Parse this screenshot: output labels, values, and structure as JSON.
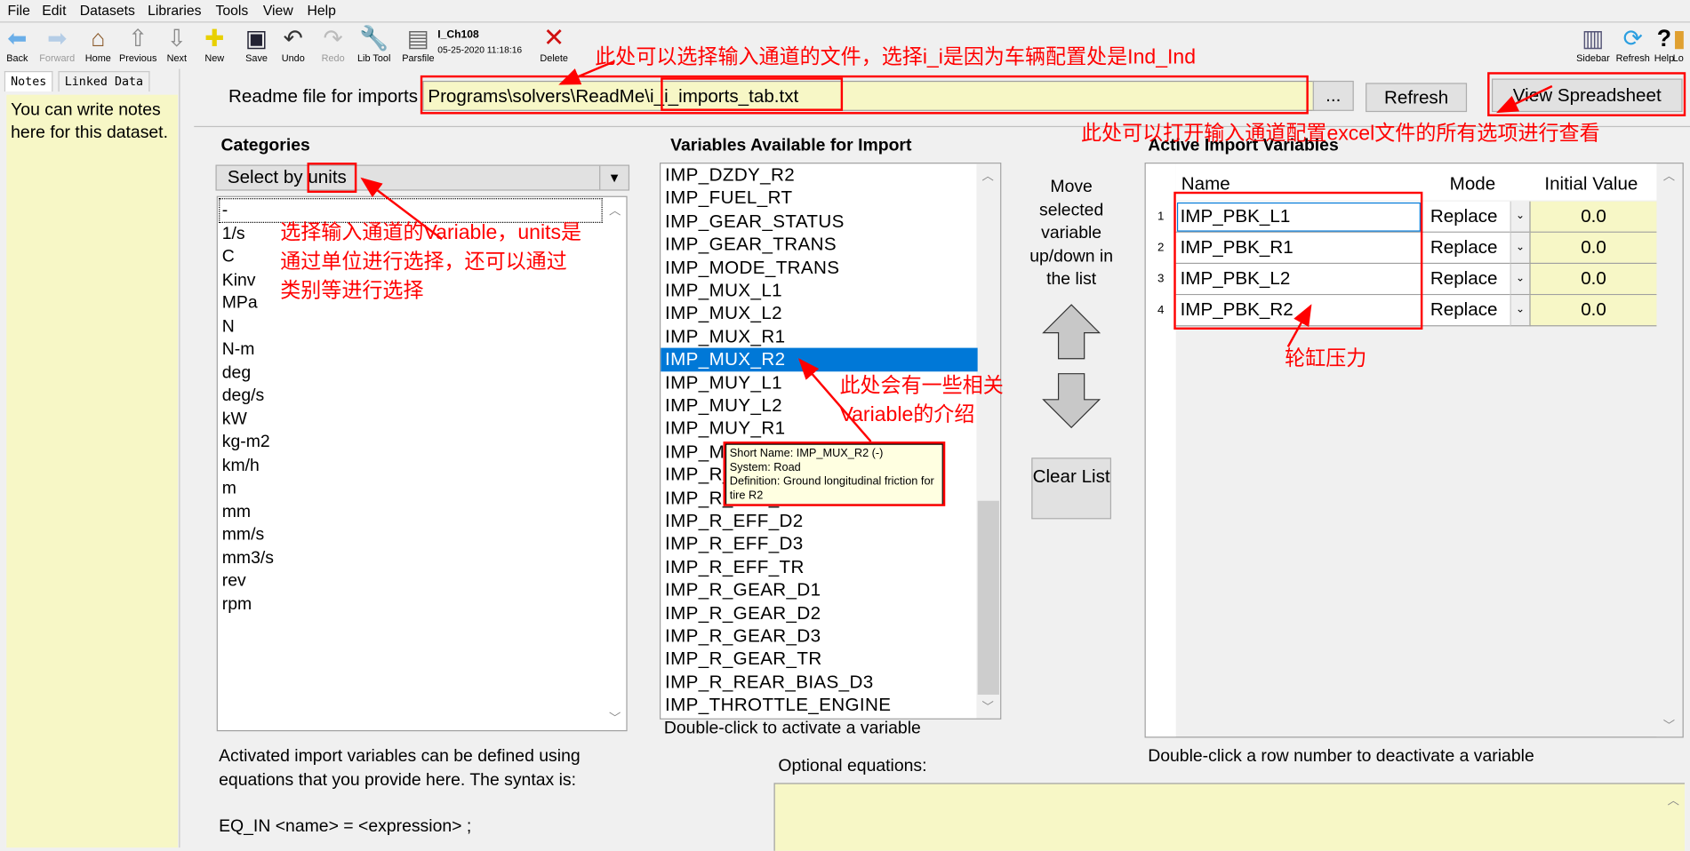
{
  "menu": [
    "File",
    "Edit",
    "Datasets",
    "Libraries",
    "Tools",
    "View",
    "Help"
  ],
  "toolbar": {
    "left": [
      {
        "label": "Back",
        "icon": "back-arrow-icon",
        "enabled": true
      },
      {
        "label": "Forward",
        "icon": "forward-arrow-icon",
        "enabled": false
      },
      {
        "label": "Home",
        "icon": "home-icon",
        "enabled": true
      },
      {
        "label": "Previous",
        "icon": "up-arrow-icon",
        "enabled": true
      },
      {
        "label": "Next",
        "icon": "down-arrow-icon",
        "enabled": true
      },
      {
        "label": "New",
        "icon": "new-icon",
        "enabled": true
      },
      {
        "label": "Save",
        "icon": "floppy-icon",
        "enabled": true
      },
      {
        "label": "Undo",
        "icon": "undo-icon",
        "enabled": true
      },
      {
        "label": "Redo",
        "icon": "redo-icon",
        "enabled": false
      },
      {
        "label": "Lib Tool",
        "icon": "wrench-icon",
        "enabled": true
      },
      {
        "label": "Parsfile",
        "icon": "document-icon",
        "enabled": true
      }
    ],
    "dataset_title": "I_Ch108",
    "dataset_date": "05-25-2020 11:18:16",
    "delete_label": "Delete",
    "right": [
      {
        "label": "Sidebar",
        "icon": "sidebar-icon"
      },
      {
        "label": "Refresh",
        "icon": "refresh-icon"
      },
      {
        "label": "Help",
        "icon": "help-icon"
      },
      {
        "label": "Lo",
        "icon": "lock-icon"
      }
    ]
  },
  "sidebar": {
    "tabs": [
      "Notes",
      "Linked Data"
    ],
    "notes_text": "You can write notes here for this dataset."
  },
  "readme": {
    "label": "Readme file for imports",
    "value": "Programs\\solvers\\ReadMe\\i_i_imports_tab.txt",
    "browse_label": "...",
    "refresh_label": "Refresh",
    "view_label": "View Spreadsheet"
  },
  "categories": {
    "title": "Categories",
    "select_value": "Select by units",
    "items": [
      "-",
      "1/s",
      "C",
      "Kinv",
      "MPa",
      "N",
      "N-m",
      "deg",
      "deg/s",
      "kW",
      "kg-m2",
      "km/h",
      "m",
      "mm",
      "mm/s",
      "mm3/s",
      "rev",
      "rpm"
    ]
  },
  "variables": {
    "title": "Variables Available for Import",
    "items": [
      "IMP_DZDY_R2",
      "IMP_FUEL_RT",
      "IMP_GEAR_STATUS",
      "IMP_GEAR_TRANS",
      "IMP_MODE_TRANS",
      "IMP_MUX_L1",
      "IMP_MUX_L2",
      "IMP_MUX_R1",
      "IMP_MUX_R2",
      "IMP_MUY_L1",
      "IMP_MUY_L2",
      "IMP_MUY_R1",
      "IMP_MUY_R2",
      "IMP_R_EFF_D1",
      "IMP_R_EFF_D1",
      "IMP_R_EFF_D2",
      "IMP_R_EFF_D3",
      "IMP_R_EFF_TR",
      "IMP_R_GEAR_D1",
      "IMP_R_GEAR_D2",
      "IMP_R_GEAR_D3",
      "IMP_R_GEAR_TR",
      "IMP_R_REAR_BIAS_D3",
      "IMP_THROTTLE_ENGINE"
    ],
    "selected": "IMP_MUX_R2",
    "hint": "Double-click to activate a variable",
    "tooltip": [
      "Short Name: IMP_MUX_R2 (-)",
      "System: Road",
      "Definition: Ground longitudinal friction for",
      "tire R2"
    ]
  },
  "move": {
    "text": "Move selected variable up/down in the list",
    "clear_label": "Clear List"
  },
  "active": {
    "title": "Active Import Variables",
    "columns": [
      "Name",
      "Mode",
      "Initial Value"
    ],
    "rows": [
      {
        "num": "1",
        "name": "IMP_PBK_L1",
        "mode": "Replace",
        "initial": "0.0"
      },
      {
        "num": "2",
        "name": "IMP_PBK_R1",
        "mode": "Replace",
        "initial": "0.0"
      },
      {
        "num": "3",
        "name": "IMP_PBK_L2",
        "mode": "Replace",
        "initial": "0.0"
      },
      {
        "num": "4",
        "name": "IMP_PBK_R2",
        "mode": "Replace",
        "initial": "0.0"
      }
    ],
    "hint": "Double-click a row number to deactivate a variable"
  },
  "equations": {
    "help_line1": "Activated import variables can be defined using",
    "help_line2": "equations that you provide here.  The syntax is:",
    "syntax": "EQ_IN <name> = <expression> ;",
    "label": "Optional equations:",
    "value": ""
  },
  "annotations": {
    "readme_note": "此处可以选择输入通道的文件，选择i_i是因为车辆配置处是Ind_Ind",
    "spreadsheet_note": "此处可以打开输入通道配置excel文件的所有选项进行查看",
    "units_note": [
      "选择输入通道的Variable，units是",
      "通过单位进行选择，还可以通过",
      "类别等进行选择"
    ],
    "tooltip_note": [
      "此处会有一些相关",
      "Variable的介绍"
    ],
    "pressure_note": "轮缸压力",
    "color": "#ff0000"
  },
  "colors": {
    "selection": "#0078d7",
    "field_yellow": "#f7f7c6",
    "window_bg": "#f0f0f0"
  }
}
